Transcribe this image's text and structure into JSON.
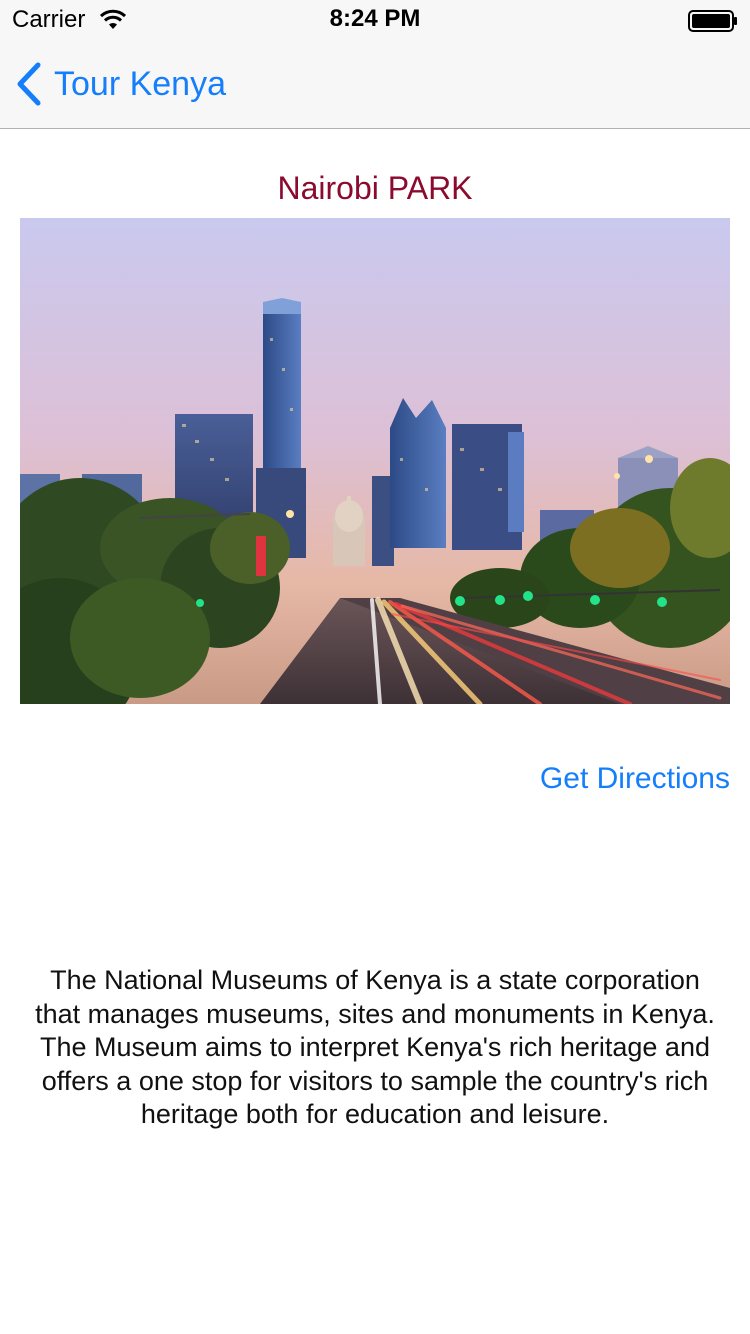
{
  "status_bar": {
    "carrier": "Carrier",
    "time": "8:24 PM",
    "wifi_icon": "wifi-icon",
    "battery_icon": "battery-icon"
  },
  "nav": {
    "back_icon": "chevron-left-icon",
    "back_label": "Tour Kenya"
  },
  "page": {
    "title": "Nairobi PARK",
    "image": "city-skyline-photo",
    "directions_label": "Get Directions",
    "description_p1": "The National Museums of Kenya is a state corporation that manages museums, sites and monuments in Kenya.",
    "description_p2": "The Museum aims to interpret Kenya's rich heritage and offers a one stop for visitors to sample the country's rich heritage both for education and leisure."
  },
  "colors": {
    "accent": "#157efb",
    "title": "#8b0a2e",
    "bar_background": "#f7f7f7"
  }
}
